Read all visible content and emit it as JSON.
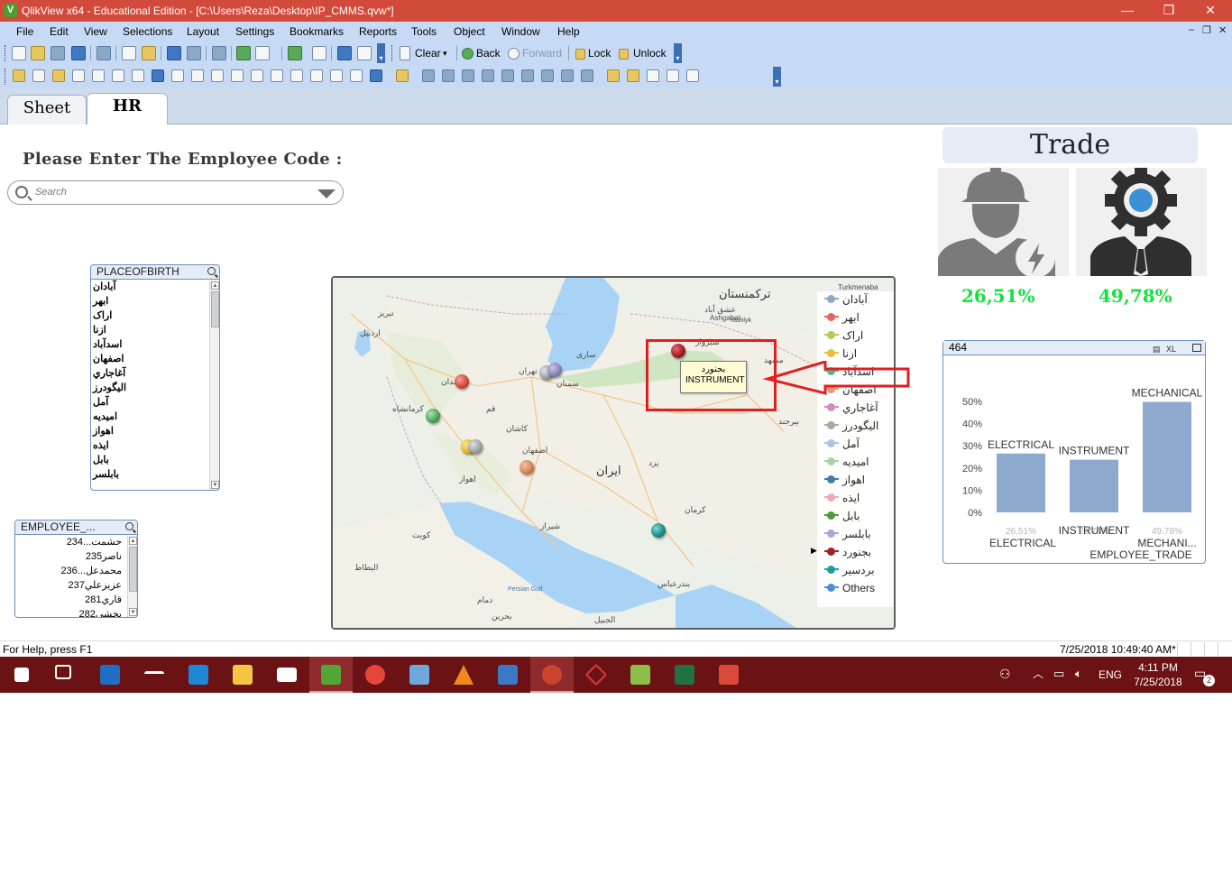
{
  "window": {
    "title": "QlikView x64 - Educational Edition - [C:\\Users\\Reza\\Desktop\\IP_CMMS.qvw*]",
    "app_icon": "V",
    "controls": {
      "minimize": "—",
      "restore": "❐",
      "close": "✕"
    }
  },
  "menu": {
    "items": [
      "File",
      "Edit",
      "View",
      "Selections",
      "Layout",
      "Settings",
      "Bookmarks",
      "Reports",
      "Tools",
      "Object",
      "Window",
      "Help"
    ],
    "doc_controls": {
      "minimize": "–",
      "restore": "❐",
      "close": "✕"
    }
  },
  "toolbar": {
    "clear_label": "Clear",
    "back_label": "Back",
    "forward_label": "Forward",
    "lock_label": "Lock",
    "unlock_label": "Unlock"
  },
  "tabs": [
    {
      "label": "Sheet",
      "active": false
    },
    {
      "label": "HR",
      "active": true
    }
  ],
  "sheet": {
    "prompt_label": "Please Enter The Employee Code :",
    "search_placeholder": "Search"
  },
  "listbox_place": {
    "caption": "PLACEOFBIRTH",
    "items": [
      "آبادان",
      "ابهر",
      "اراک",
      "ازنا",
      "اسدآباد",
      "اصفهان",
      "آغاجاري",
      "اليگودرز",
      "آمل",
      "اميديه",
      "اهواز",
      "ایذه",
      "بابل",
      "بابلسر"
    ]
  },
  "listbox_employee": {
    "caption": "EMPLOYEE_...",
    "items": [
      {
        "code": "234",
        "name": "حشمت..."
      },
      {
        "code": "235",
        "name": "ناصر"
      },
      {
        "code": "236",
        "name": "محمدعل..."
      },
      {
        "code": "237",
        "name": "عزيزعلي"
      },
      {
        "code": "281",
        "name": "قاري"
      },
      {
        "code": "282",
        "name": "بخشي"
      }
    ]
  },
  "map": {
    "labels": {
      "turkmenistan": "ترکمنستان",
      "turkmenabat": "Turkmenaba",
      "ashgabat_fa": "عشق آباد",
      "ashgabat": "Ashgabat",
      "yashlyk": "Yashlyk",
      "tabriz": "تبریز",
      "tehran": "تهران",
      "iran": "ایران",
      "isfahan": "اصفهان",
      "shiraz": "شیراز",
      "ahvaz": "اهواز",
      "mashhad": "مشهد",
      "kerman": "کرمان",
      "kuwait": "کویت",
      "persian_gulf": "Persian Gulf",
      "bahrain": "بحرین",
      "kermanshah": "کرمانشاه",
      "qom": "قم",
      "kashan": "کاشان",
      "yazd": "یزد",
      "bandar": "بندرعباس",
      "dammam": "دمام",
      "riyadh": "الجبيل",
      "basra": "البطاط",
      "birjand": "بیرجند",
      "hamedan": "همدان",
      "ardabil": "اردبیل",
      "sari": "ساری",
      "semnan": "سمنان",
      "sabzevar": "سبزوار"
    },
    "legend": [
      {
        "label": "آبادان",
        "color": "#8aa8c9"
      },
      {
        "label": "ابهر",
        "color": "#e8635b"
      },
      {
        "label": "اراک",
        "color": "#b7c854"
      },
      {
        "label": "ازنا",
        "color": "#e6c03c"
      },
      {
        "label": "اسدآباد",
        "color": "#5bb38a"
      },
      {
        "label": "اصفهان",
        "color": "#e29a7a"
      },
      {
        "label": "آغاجاري",
        "color": "#d889c4"
      },
      {
        "label": "اليگودرز",
        "color": "#a8a8a8"
      },
      {
        "label": "آمل",
        "color": "#a9c6e4"
      },
      {
        "label": "اميديه",
        "color": "#9ed8a0"
      },
      {
        "label": "اهواز",
        "color": "#3d7ea6"
      },
      {
        "label": "ایذه",
        "color": "#f1a9b8"
      },
      {
        "label": "بابل",
        "color": "#4e9b3f"
      },
      {
        "label": "بابلسر",
        "color": "#b9a1d3"
      },
      {
        "label": "بجنورد",
        "color": "#a31f24"
      },
      {
        "label": "بردسير",
        "color": "#1c9e9a"
      },
      {
        "label": "Others",
        "color": "#4b8fd6"
      }
    ],
    "tooltip": {
      "line1": "بجنورد",
      "line2": "INSTRUMENT"
    },
    "pin_colors": {
      "bojnurd": "#a31f24",
      "ardabil_red": "#d44a3e",
      "amol_grey": "#9aa0ac",
      "amol_purple": "#8c86b8",
      "kermanshah": "#4fa65c",
      "arak_yellow": "#e2b72e",
      "arak_grey": "#a3a3a3",
      "isfahan": "#d3875a",
      "kerman": "#1c8f8a"
    }
  },
  "trade": {
    "title": "Trade",
    "electrical_pct": "26,51%",
    "mechanical_pct": "49,78%"
  },
  "chart_box": {
    "caption": "464",
    "xl_label": "XL"
  },
  "chart_data": {
    "type": "bar",
    "categories": [
      "ELECTRICAL",
      "INSTRUMENT",
      "MECHANICAL"
    ],
    "values": [
      26.51,
      23.71,
      49.78
    ],
    "top_labels": [
      "ELECTRICAL",
      "INSTRUMENT",
      "MECHANICAL"
    ],
    "value_labels": [
      "26.51%",
      "23.71%",
      "49.78%"
    ],
    "x_tick_labels": [
      "ELECTRICAL",
      "INSTRUMENT",
      "MECHANI..."
    ],
    "xlabel": "EMPLOYEE_TRADE",
    "ylabel": "",
    "ylim": [
      0,
      50
    ],
    "y_ticks": [
      "0%",
      "10%",
      "20%",
      "30%",
      "40%",
      "50%"
    ],
    "bar_color": "#8ea9ce",
    "grid": false
  },
  "status": {
    "help": "For Help, press F1",
    "timestamp": "7/25/2018 10:49:40 AM*"
  },
  "taskbar": {
    "language": "ENG",
    "time": "4:11 PM",
    "date": "7/25/2018",
    "notifications": "2",
    "apps": [
      {
        "name": "windows-start-icon",
        "color": "#ffffff"
      },
      {
        "name": "task-view-icon",
        "color": "#ffffff"
      },
      {
        "name": "outlook-icon",
        "color": "#1f6ec2"
      },
      {
        "name": "network-tool-icon",
        "color": "#ffffff"
      },
      {
        "name": "edge-icon",
        "color": "#1e88d8"
      },
      {
        "name": "file-explorer-icon",
        "color": "#f3c745"
      },
      {
        "name": "mail-icon",
        "color": "#ffffff"
      },
      {
        "name": "qlikview-icon",
        "color": "#52a637"
      },
      {
        "name": "chrome-icon",
        "color": "#e6453a"
      },
      {
        "name": "computer-icon",
        "color": "#6fa8dc"
      },
      {
        "name": "vlc-icon",
        "color": "#f08a18"
      },
      {
        "name": "blue-app-icon",
        "color": "#3b78c6"
      },
      {
        "name": "color-wheel-icon",
        "color": "#c9452d"
      },
      {
        "name": "diamond-app-icon",
        "color": "#c33"
      },
      {
        "name": "media-player-icon",
        "color": "#8cbf4a"
      },
      {
        "name": "excel-icon",
        "color": "#1f7244"
      },
      {
        "name": "game-icon",
        "color": "#d94a3a"
      }
    ]
  }
}
